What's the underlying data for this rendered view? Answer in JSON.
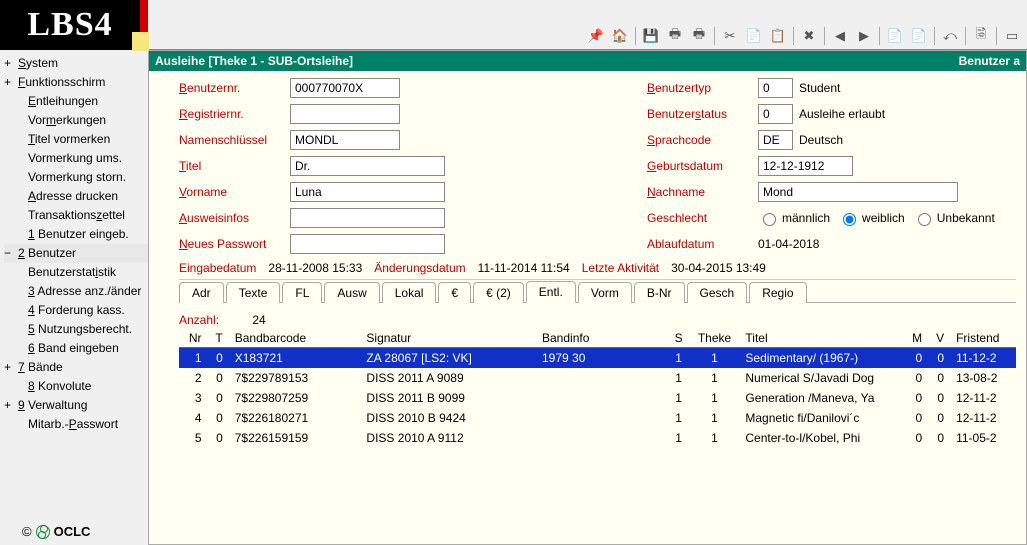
{
  "logo": "LBS4",
  "toolbar": {
    "icons": [
      "📌",
      "🏠",
      "💾",
      "🖶",
      "🖶",
      "✂",
      "📄",
      "📋",
      "✖",
      "◀",
      "▶",
      "📄",
      "📄",
      "⤺",
      "🗟",
      "▭"
    ]
  },
  "titlebar": {
    "left": "Ausleihe [Theke 1 - SUB-Ortsleihe]",
    "right": "Benutzer a"
  },
  "sidebar": {
    "items": [
      {
        "label": "System",
        "u": "S",
        "cls": "top-level"
      },
      {
        "label": "Funktionsschirm",
        "u": "F",
        "cls": "top-level"
      },
      {
        "label": "Entleihungen",
        "u": "E",
        "cls": "sub"
      },
      {
        "label": "Vormerkungen",
        "u": "m",
        "cls": "sub",
        "pre": "Vor"
      },
      {
        "label": "Titel vormerken",
        "u": "T",
        "cls": "sub"
      },
      {
        "label": "Vormerkung ums.",
        "cls": "sub"
      },
      {
        "label": "Vormerkung storn.",
        "cls": "sub"
      },
      {
        "label": "Adresse drucken",
        "u": "A",
        "cls": "sub"
      },
      {
        "label": "Transaktionszettel",
        "u": "z",
        "cls": "sub",
        "pre": "Transaktions"
      },
      {
        "label": "1 Benutzer eingeb.",
        "u": "1",
        "cls": "sub"
      },
      {
        "label": "2 Benutzer",
        "u": "2",
        "cls": "top-level minus active"
      },
      {
        "label": "Benutzerstatistik",
        "u": "i",
        "cls": "sub",
        "pre": "Benutzerstat"
      },
      {
        "label": "3 Adresse anz./änder",
        "u": "3",
        "cls": "sub"
      },
      {
        "label": "4 Forderung kass.",
        "u": "4",
        "cls": "sub"
      },
      {
        "label": "5 Nutzungsberecht.",
        "u": "5",
        "cls": "sub"
      },
      {
        "label": "6 Band eingeben",
        "u": "6",
        "cls": "sub"
      },
      {
        "label": "7 Bände",
        "u": "7",
        "cls": "top-level"
      },
      {
        "label": "8 Konvolute",
        "u": "8",
        "cls": "sub"
      },
      {
        "label": "9 Verwaltung",
        "u": "9",
        "cls": "top-level"
      },
      {
        "label": "Mitarb.-Passwort",
        "u": "P",
        "cls": "sub",
        "pre": "Mitarb.-"
      }
    ],
    "footer": "OCLC"
  },
  "form": {
    "left": {
      "benutzernr": {
        "label": "Benutzernr.",
        "u": "B",
        "value": "000770070X"
      },
      "registriernr": {
        "label": "Registriernr.",
        "u": "R",
        "value": ""
      },
      "namenschl": {
        "label": "Namenschlüssel",
        "value": "MONDL"
      },
      "titel": {
        "label": "Titel",
        "u": "T",
        "value": "Dr."
      },
      "vorname": {
        "label": "Vorname",
        "u": "V",
        "value": "Luna"
      },
      "ausweis": {
        "label": "Ausweisinfos",
        "u": "A",
        "value": ""
      },
      "neuespw": {
        "label": "Neues Passwort",
        "u": "N",
        "value": ""
      }
    },
    "right": {
      "benutzertyp": {
        "label": "Benutzertyp",
        "u": "B",
        "value": "0",
        "desc": "Student"
      },
      "benutzerstatus": {
        "label": "Benutzerstatus",
        "u": "s",
        "pre": "Benutzer",
        "value": "0",
        "desc": "Ausleihe erlaubt"
      },
      "sprachcode": {
        "label": "Sprachcode",
        "u": "S",
        "value": "DE",
        "desc": "Deutsch"
      },
      "geburt": {
        "label": "Geburtsdatum",
        "u": "G",
        "value": "12-12-1912"
      },
      "nachname": {
        "label": "Nachname",
        "u": "N",
        "value": "Mond"
      },
      "geschlecht": {
        "label": "Geschlecht",
        "options": [
          {
            "key": "m",
            "label": "männlich",
            "u": "m",
            "checked": false
          },
          {
            "key": "w",
            "label": "weiblich",
            "u": "w",
            "checked": true
          },
          {
            "key": "u",
            "label": "Unbekannt",
            "u": "U",
            "checked": false
          }
        ]
      },
      "ablauf": {
        "label": "Ablaufdatum",
        "value": "01-04-2018"
      }
    },
    "dates": {
      "eingabe": {
        "label": "Eingabedatum",
        "value": "28-11-2008 15:33"
      },
      "aenderung": {
        "label": "Änderungsdatum",
        "value": "11-11-2014 11:54"
      },
      "letzte": {
        "label": "Letzte Aktivität",
        "value": "30-04-2015 13:49"
      }
    }
  },
  "tabs": [
    {
      "label": "Adr"
    },
    {
      "label": "Texte"
    },
    {
      "label": "FL"
    },
    {
      "label": "Ausw"
    },
    {
      "label": "Lokal"
    },
    {
      "label": "€"
    },
    {
      "label": "€ (2)"
    },
    {
      "label": "Entl.",
      "active": true
    },
    {
      "label": "Vorm"
    },
    {
      "label": "B-Nr"
    },
    {
      "label": "Gesch"
    },
    {
      "label": "Regio"
    }
  ],
  "table": {
    "count_label": "Anzahl:",
    "count": "24",
    "columns": [
      "Nr",
      "T",
      "Bandbarcode",
      "Signatur",
      "Bandinfo",
      "S",
      "Theke",
      "Titel",
      "M",
      "V",
      "Fristend"
    ],
    "rows": [
      {
        "nr": "1",
        "t": "0",
        "bc": "X183721",
        "sig": "ZA 28067 [LS2: VK]",
        "bi": "1979 30",
        "s": "1",
        "th": "1",
        "ti": "Sedimentary/ (1967-)",
        "m": "0",
        "v": "0",
        "fr": "11-12-2",
        "sel": true
      },
      {
        "nr": "2",
        "t": "0",
        "bc": "7$229789153",
        "sig": "DISS 2011 A 9089",
        "bi": "",
        "s": "1",
        "th": "1",
        "ti": "Numerical S/Javadi Dog",
        "m": "0",
        "v": "0",
        "fr": "13-08-2"
      },
      {
        "nr": "3",
        "t": "0",
        "bc": "7$229807259",
        "sig": "DISS 2011 B 9099",
        "bi": "",
        "s": "1",
        "th": "1",
        "ti": "Generation /Maneva, Ya",
        "m": "0",
        "v": "0",
        "fr": "12-11-2"
      },
      {
        "nr": "4",
        "t": "0",
        "bc": "7$226180271",
        "sig": "DISS 2010 B 9424",
        "bi": "",
        "s": "1",
        "th": "1",
        "ti": "Magnetic fi/Danilovi´c",
        "m": "0",
        "v": "0",
        "fr": "12-11-2"
      },
      {
        "nr": "5",
        "t": "0",
        "bc": "7$226159159",
        "sig": "DISS 2010 A 9112",
        "bi": "",
        "s": "1",
        "th": "1",
        "ti": "Center-to-l/Kobel, Phi",
        "m": "0",
        "v": "0",
        "fr": "11-05-2"
      }
    ]
  }
}
